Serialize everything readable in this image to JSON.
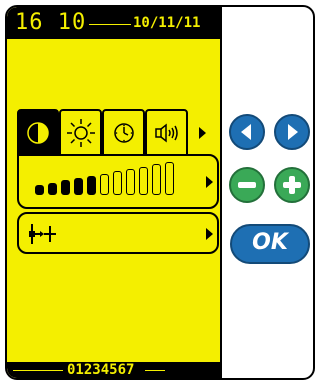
{
  "status": {
    "time": "16 10",
    "date": "10/11/11"
  },
  "tabs": [
    {
      "icon": "contrast-icon",
      "active": true
    },
    {
      "icon": "brightness-icon",
      "active": false
    },
    {
      "icon": "clock-icon",
      "active": false
    },
    {
      "icon": "speaker-icon",
      "active": false
    }
  ],
  "level": {
    "value": 5,
    "max": 11
  },
  "footer": {
    "code": "01234567"
  },
  "buttons": {
    "ok_label": "OK"
  },
  "colors": {
    "screen": "#f4ef00",
    "blue_button": "#1e6fb3",
    "green_button": "#3aa957"
  }
}
